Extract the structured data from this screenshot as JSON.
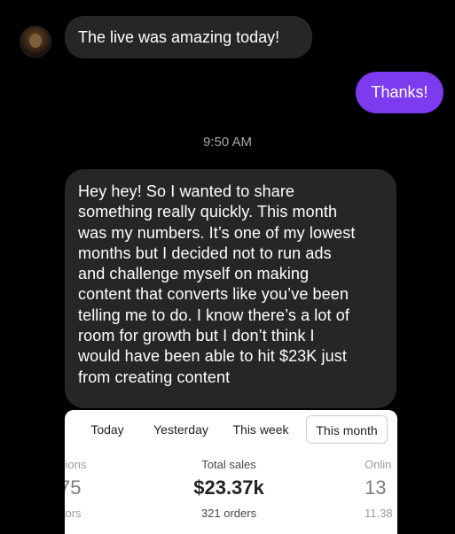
{
  "conversation": {
    "received_1": "The live was amazing today!",
    "sent_1": "Thanks!",
    "timestamp": "9:50 AM",
    "received_2_lines": [
      "Hey hey! So I wanted to share",
      "something really quickly. This month",
      "was my numbers. It’s one of my lowest",
      "months but I decided not to run ads",
      "and challenge myself on making",
      "content that converts like you’ve been",
      "telling me to do. I know there’s a lot of",
      "room for growth but I don’t think I",
      "would have been able to hit $23K just",
      "from creating content"
    ]
  },
  "analytics": {
    "tabs": [
      "Today",
      "Yesterday",
      "This week",
      "This month"
    ],
    "active_tab": "This month",
    "left_partial": {
      "label": "sions",
      "value": "75",
      "sub": "itors"
    },
    "total_sales": {
      "label": "Total sales",
      "value": "$23.37k",
      "sub": "321 orders"
    },
    "right_partial": {
      "label": "Onlin",
      "value": "13",
      "sub": "11.38"
    }
  },
  "colors": {
    "background": "#000000",
    "incoming_bubble": "#262626",
    "outgoing_bubble": "#7d3bf0",
    "timestamp": "#a8a8a8"
  }
}
